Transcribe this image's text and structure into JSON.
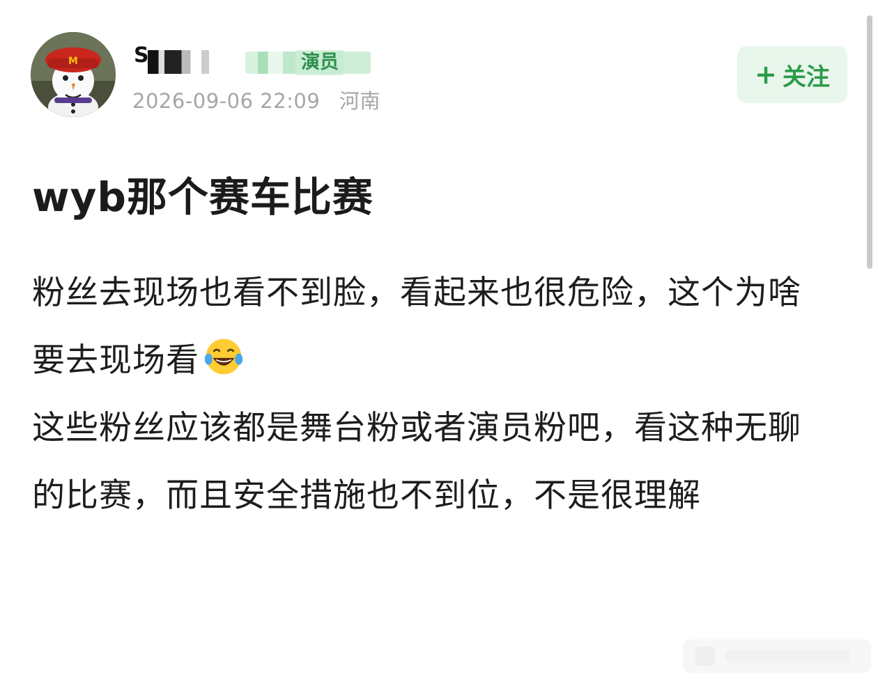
{
  "post": {
    "username": "S",
    "badge": "演员",
    "date": "2026-09-06 22:09",
    "location": "河南",
    "follow_label": "关注",
    "follow_icon": "+",
    "title": "wyb那个赛车比赛",
    "paragraphs": [
      "粉丝去现场也看不到脸，看起来也很危险，这个为啥要去现场看",
      "这些粉丝应该都是舞台粉或者演员粉吧，看这种无聊的比赛，而且安全措施也不到位，不是很理解"
    ],
    "emoji": "laughing-with-tears-emoji"
  },
  "colors": {
    "accent": "#2d9a4b",
    "follow_bg": "#e8f6ec",
    "meta": "#a6a6a6"
  }
}
